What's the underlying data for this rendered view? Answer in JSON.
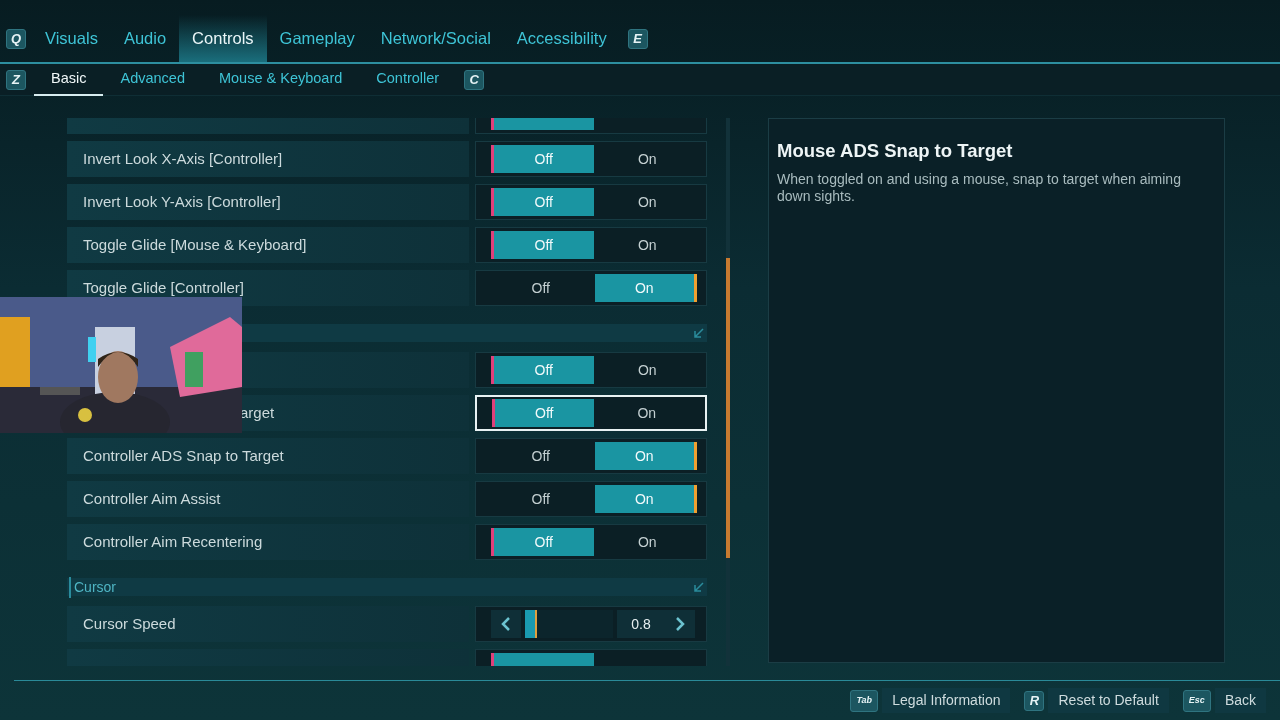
{
  "top_tabs": {
    "prev_key": "Q",
    "next_key": "E",
    "items": [
      {
        "label": "Visuals",
        "selected": false
      },
      {
        "label": "Audio",
        "selected": false
      },
      {
        "label": "Controls",
        "selected": true
      },
      {
        "label": "Gameplay",
        "selected": false
      },
      {
        "label": "Network/Social",
        "selected": false
      },
      {
        "label": "Accessibility",
        "selected": false
      }
    ]
  },
  "sub_tabs": {
    "prev_key": "Z",
    "next_key": "C",
    "items": [
      {
        "label": "Basic",
        "selected": true
      },
      {
        "label": "Advanced",
        "selected": false
      },
      {
        "label": "Mouse & Keyboard",
        "selected": false
      },
      {
        "label": "Controller",
        "selected": false
      }
    ]
  },
  "settings": [
    {
      "kind": "toggle",
      "on": false,
      "focused": false
    },
    {
      "kind": "toggle",
      "label": "Invert Look X-Axis [Controller]",
      "off_label": "Off",
      "on_label": "On",
      "on": false,
      "focused": false
    },
    {
      "kind": "toggle",
      "label": "Invert Look Y-Axis [Controller]",
      "off_label": "Off",
      "on_label": "On",
      "on": false,
      "focused": false
    },
    {
      "kind": "toggle",
      "label": "Toggle Glide [Mouse & Keyboard]",
      "off_label": "Off",
      "on_label": "On",
      "on": false,
      "focused": false
    },
    {
      "kind": "toggle",
      "label": "Toggle Glide [Controller]",
      "off_label": "Off",
      "on_label": "On",
      "on": true,
      "focused": false
    },
    {
      "kind": "section"
    },
    {
      "kind": "toggle",
      "off_label": "Off",
      "on_label": "On",
      "on": false,
      "focused": false
    },
    {
      "kind": "toggle",
      "label": "arget",
      "covered": true,
      "off_label": "Off",
      "on_label": "On",
      "on": false,
      "focused": true
    },
    {
      "kind": "toggle",
      "label": "Controller ADS Snap to Target",
      "off_label": "Off",
      "on_label": "On",
      "on": true,
      "focused": false
    },
    {
      "kind": "toggle",
      "label": "Controller Aim Assist",
      "off_label": "Off",
      "on_label": "On",
      "on": true,
      "focused": false
    },
    {
      "kind": "toggle",
      "label": "Controller Aim Recentering",
      "off_label": "Off",
      "on_label": "On",
      "on": false,
      "focused": false
    },
    {
      "kind": "section",
      "title": "Cursor"
    },
    {
      "kind": "slider",
      "label": "Cursor Speed",
      "level": 0.14,
      "value": "0.8"
    },
    {
      "kind": "toggle",
      "on": false,
      "focused": false
    }
  ],
  "detail": {
    "title": "Mouse ADS Snap to Target",
    "description": "When toggled on and using a mouse, snap to target when aiming down sights."
  },
  "footer": [
    {
      "key": "Tab",
      "label": "Legal Information"
    },
    {
      "key": "R",
      "label": "Reset to Default"
    },
    {
      "key": "Esc",
      "label": "Back"
    }
  ]
}
